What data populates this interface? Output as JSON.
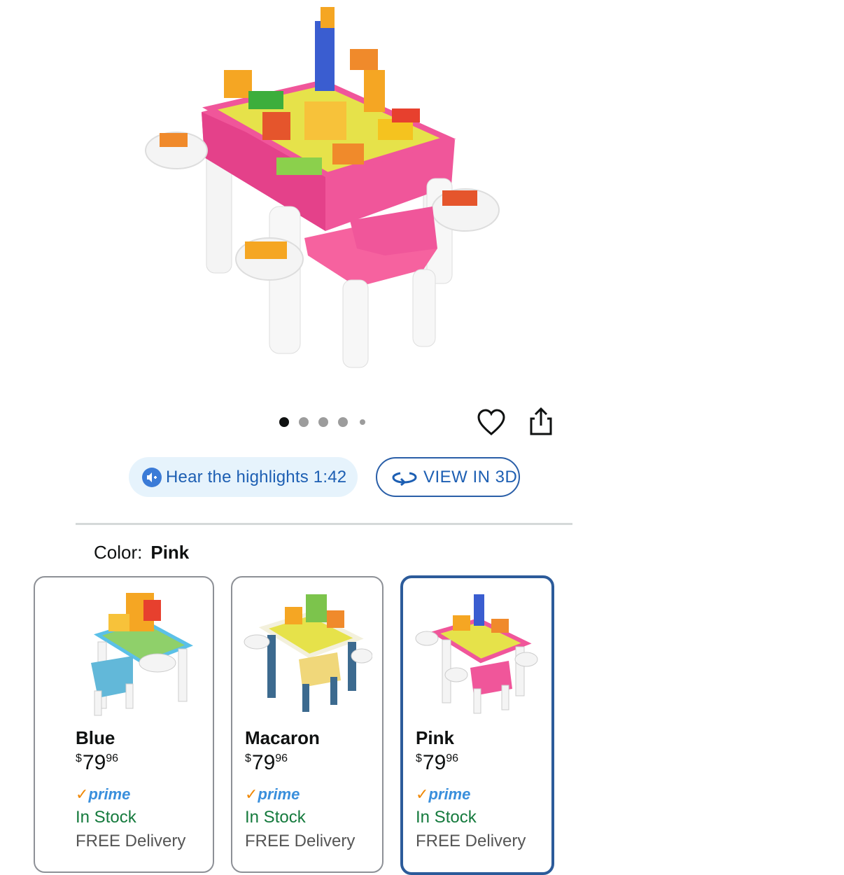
{
  "carousel": {
    "dot_count": 5,
    "active_index": 0
  },
  "actions": {
    "hear_label": "Hear the highlights 1:42",
    "view3d_label": "VIEW IN 3D"
  },
  "color_selector": {
    "label": "Color:",
    "selected": "Pink"
  },
  "variants": [
    {
      "name": "Blue",
      "currency": "$",
      "price_whole": "79",
      "price_fraction": "96",
      "prime": "prime",
      "stock": "In Stock",
      "delivery": "FREE Delivery"
    },
    {
      "name": "Macaron",
      "currency": "$",
      "price_whole": "79",
      "price_fraction": "96",
      "prime": "prime",
      "stock": "In Stock",
      "delivery": "FREE Delivery"
    },
    {
      "name": "Pink",
      "currency": "$",
      "price_whole": "79",
      "price_fraction": "96",
      "prime": "prime",
      "stock": "In Stock",
      "delivery": "FREE Delivery"
    }
  ],
  "colors": {
    "accent_blue": "#1d5fb3",
    "selected_border": "#2c5b9a",
    "in_stock_green": "#157a3d",
    "prime_blue": "#3a8fdc",
    "prime_check": "#f08804",
    "table_pink": "#f0569a",
    "table_yellow": "#e7e34a"
  }
}
